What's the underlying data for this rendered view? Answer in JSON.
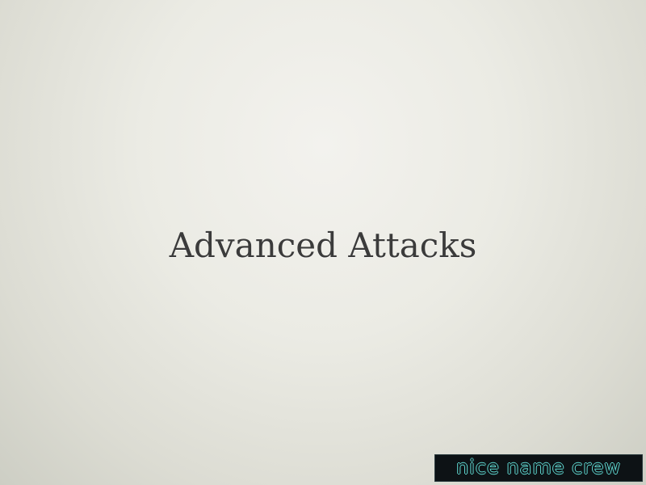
{
  "slide": {
    "title": "Advanced Attacks",
    "logo_text": "nice name crew"
  },
  "colors": {
    "background": "#ebebe4",
    "title_text": "#3b3b3b",
    "logo_background": "#0d1215",
    "logo_outline": "#5fd7d0"
  }
}
